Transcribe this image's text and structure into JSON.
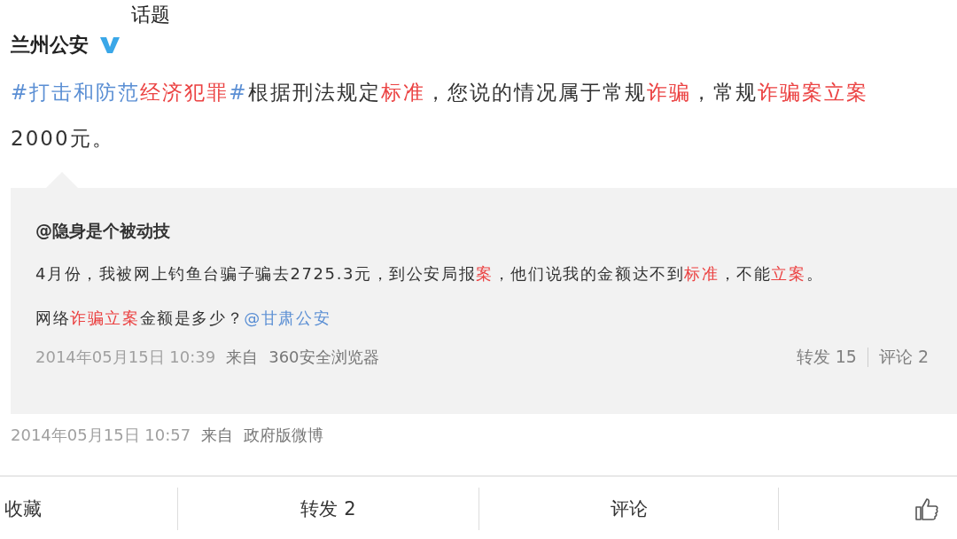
{
  "tooltip": "话题",
  "author": {
    "name": "兰州公安",
    "verified": true
  },
  "text": [
    [
      {
        "kind": "topic",
        "parts": [
          {
            "kind": "text",
            "text": "#打击和防范"
          },
          {
            "kind": "hit",
            "text": "经济犯罪"
          },
          {
            "kind": "text",
            "text": "#"
          }
        ]
      },
      {
        "kind": "text",
        "text": "根据刑法规定"
      },
      {
        "kind": "hit",
        "text": "标准"
      },
      {
        "kind": "text",
        "text": "，您说的情况属于常规"
      },
      {
        "kind": "hit",
        "text": "诈骗"
      },
      {
        "kind": "text",
        "text": "，常规"
      },
      {
        "kind": "hit",
        "text": "诈骗案立案"
      }
    ],
    [
      {
        "kind": "text",
        "text": "2000元。"
      }
    ]
  ],
  "quote": {
    "author": "@隐身是个被动技",
    "text": [
      [
        {
          "kind": "text",
          "text": "4月份，我被网上钓鱼台骗子骗去2725.3元，到公安局报"
        },
        {
          "kind": "hit",
          "text": "案"
        },
        {
          "kind": "text",
          "text": "，他们说我的金额达不到"
        },
        {
          "kind": "hit",
          "text": "标准"
        },
        {
          "kind": "text",
          "text": "，不能"
        },
        {
          "kind": "hit",
          "text": "立案"
        },
        {
          "kind": "text",
          "text": "。"
        }
      ],
      [
        {
          "kind": "text",
          "text": "网络"
        },
        {
          "kind": "hit",
          "text": "诈骗立案"
        },
        {
          "kind": "text",
          "text": "金额是多少？"
        },
        {
          "kind": "mention",
          "text": "@甘肃公安"
        }
      ]
    ],
    "time": "2014年05月15日 10:39",
    "from_label": "来自",
    "source": "360安全浏览器",
    "actions": [
      "转发 15",
      "评论 2"
    ]
  },
  "time": "2014年05月15日 10:57",
  "from_label": "来自",
  "source": "政府版微博",
  "bar": [
    "收藏",
    "转发 2",
    "评论"
  ]
}
